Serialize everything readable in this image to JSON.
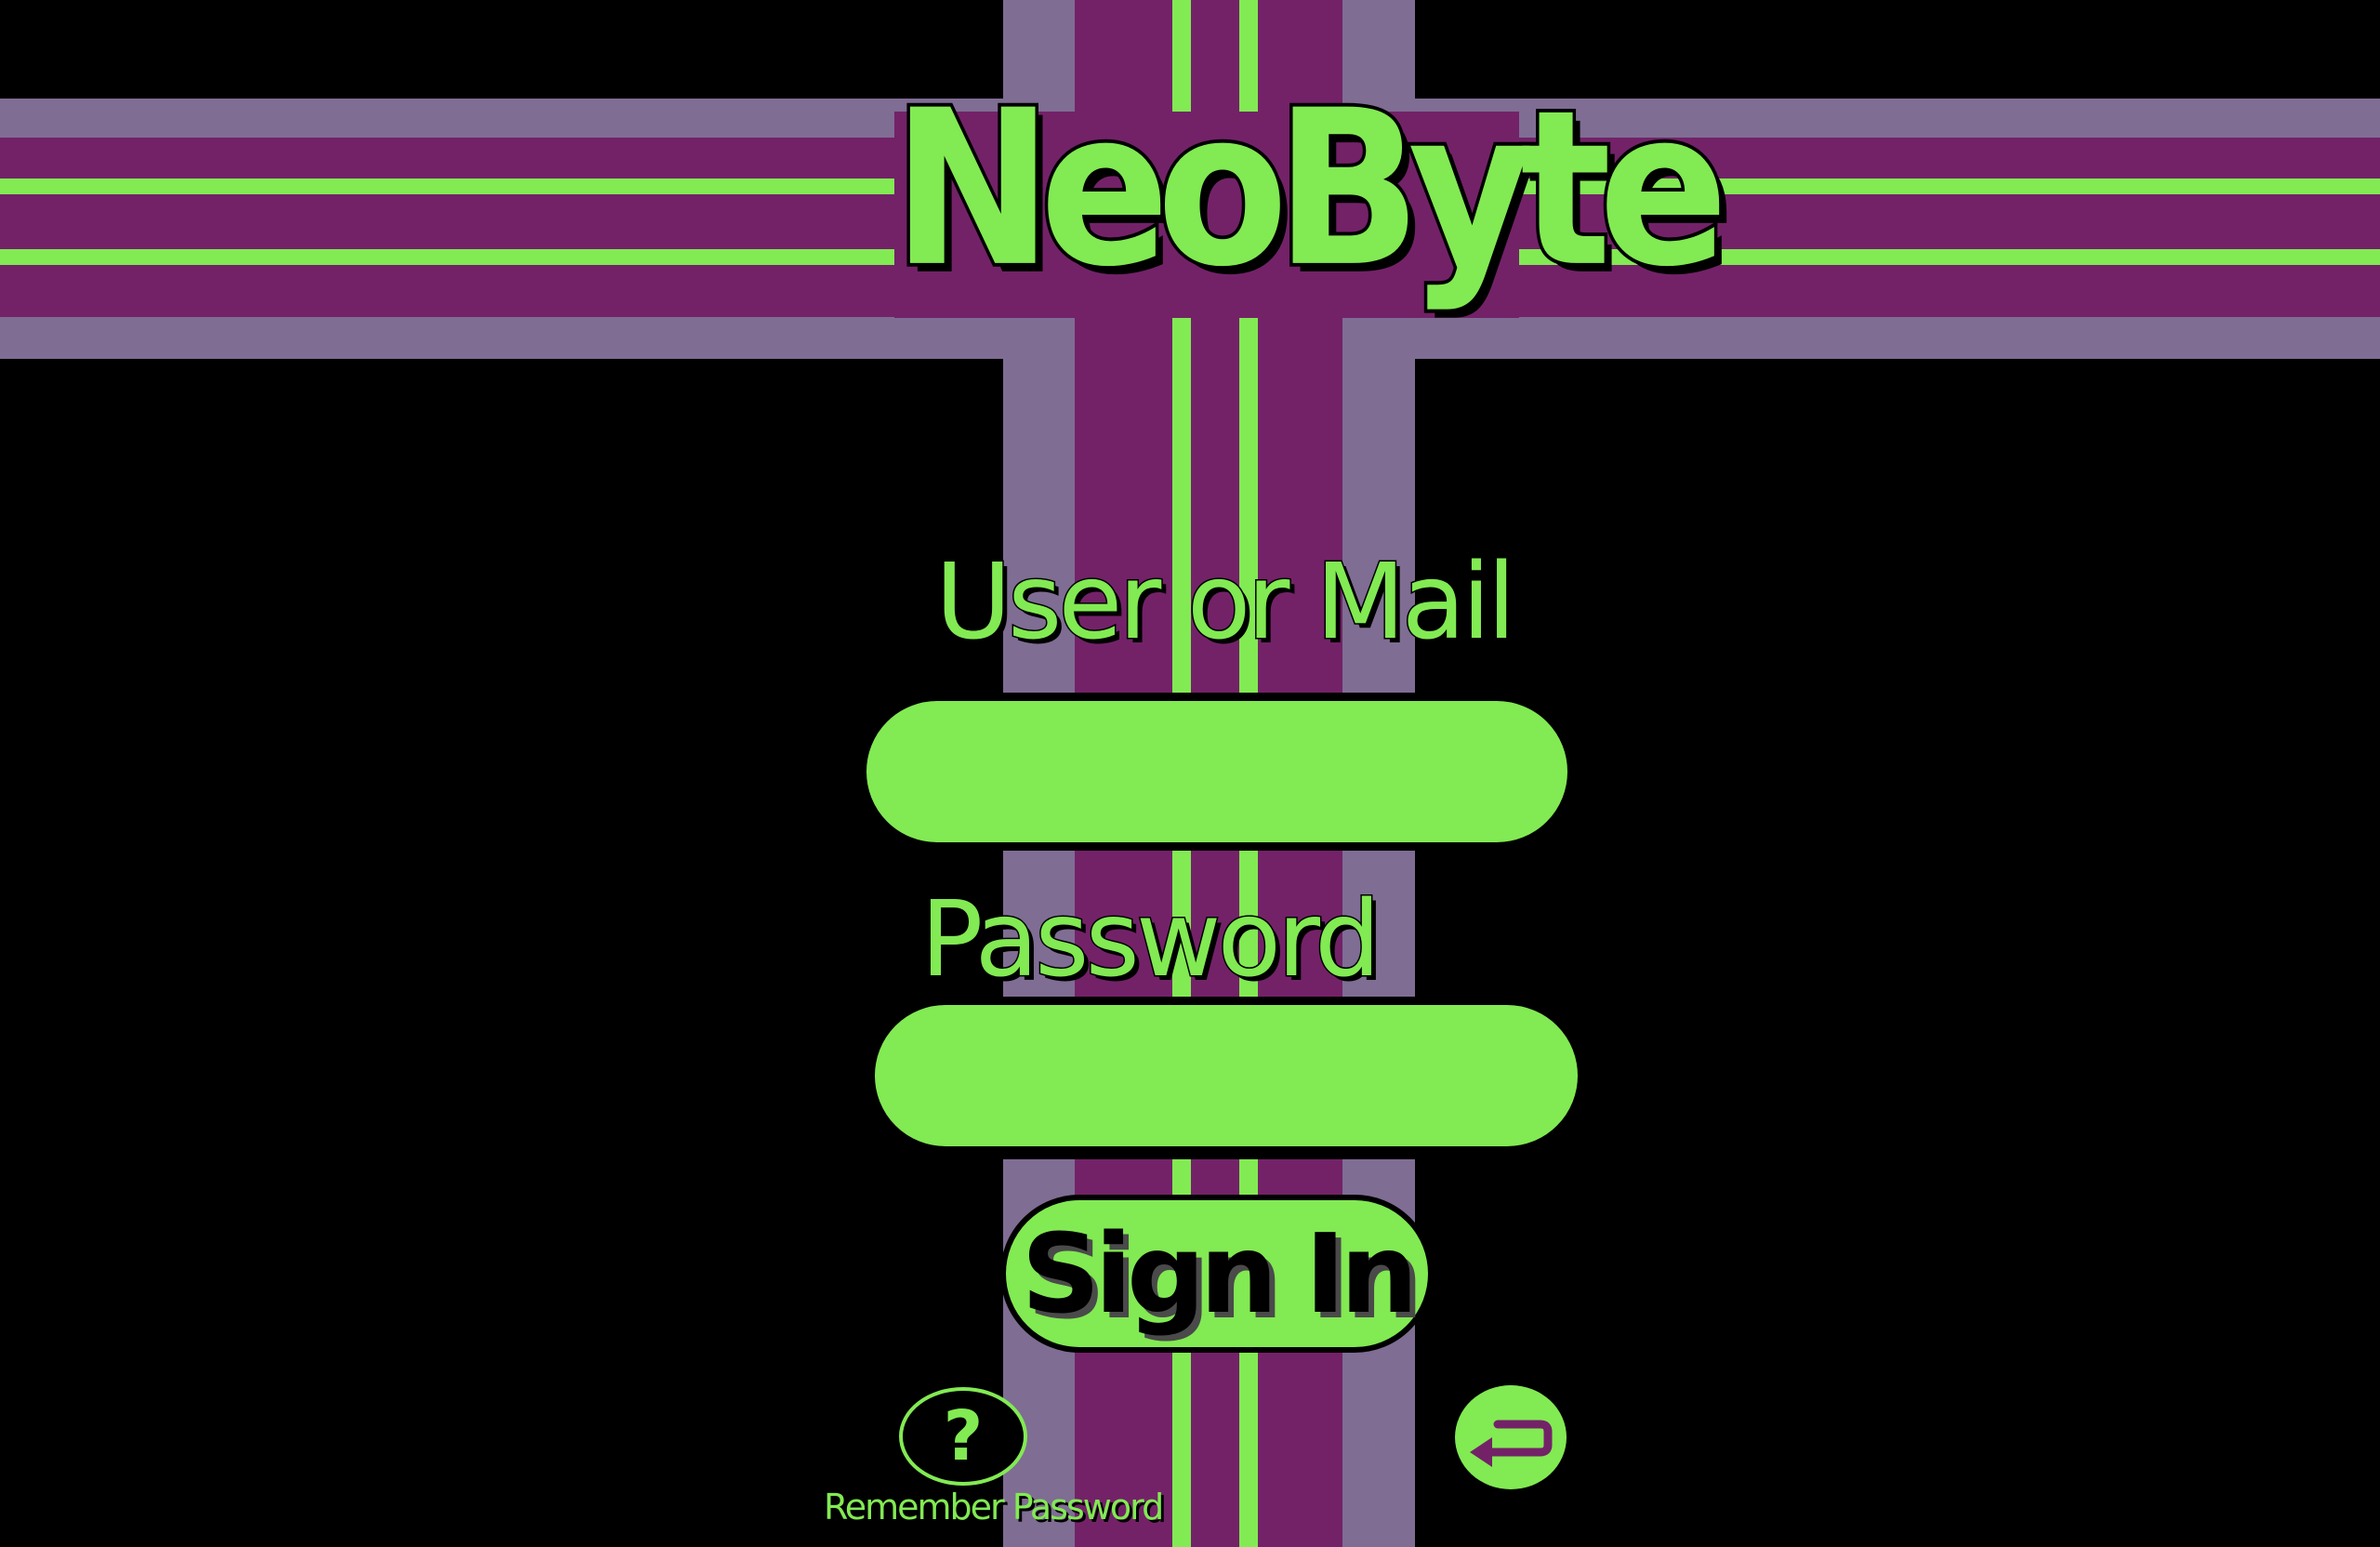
{
  "app": {
    "logo_text": "NeoByte"
  },
  "login_form": {
    "user_label": "User or Mail",
    "user_value": "",
    "password_label": "Password",
    "password_value": "",
    "sign_in_label": "Sign In"
  },
  "footer": {
    "help_glyph": "?",
    "remember_password_label": "Remember Password",
    "back_icon": "return-arrow-icon"
  },
  "colors": {
    "background": "#000000",
    "accent_green": "#82ea53",
    "stripe_purple": "#732268",
    "stripe_lilac": "#7f6d94"
  }
}
